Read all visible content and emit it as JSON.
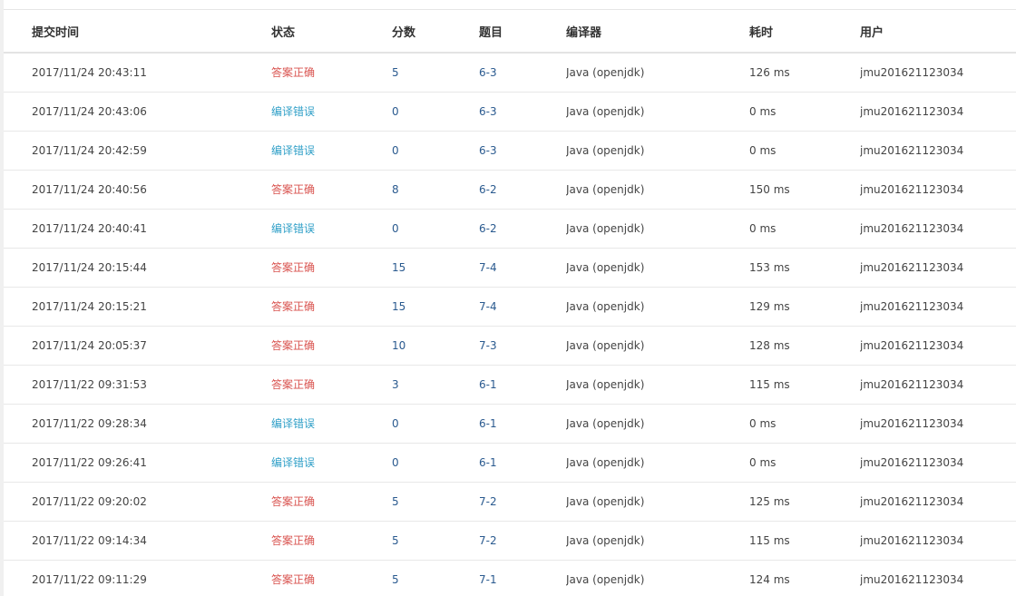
{
  "colors": {
    "accepted": "#d9534f",
    "compile_error": "#31a0c8",
    "link": "#2a5a8f"
  },
  "table": {
    "headers": [
      "提交时间",
      "状态",
      "分数",
      "题目",
      "编译器",
      "耗时",
      "用户"
    ],
    "rows": [
      {
        "time": "2017/11/24 20:43:11",
        "status": "答案正确",
        "status_type": "accepted",
        "score": "5",
        "problem": "6-3",
        "compiler": "Java (openjdk)",
        "duration": "126 ms",
        "user": "jmu201621123034"
      },
      {
        "time": "2017/11/24 20:43:06",
        "status": "编译错误",
        "status_type": "compile_error",
        "score": "0",
        "problem": "6-3",
        "compiler": "Java (openjdk)",
        "duration": "0 ms",
        "user": "jmu201621123034"
      },
      {
        "time": "2017/11/24 20:42:59",
        "status": "编译错误",
        "status_type": "compile_error",
        "score": "0",
        "problem": "6-3",
        "compiler": "Java (openjdk)",
        "duration": "0 ms",
        "user": "jmu201621123034"
      },
      {
        "time": "2017/11/24 20:40:56",
        "status": "答案正确",
        "status_type": "accepted",
        "score": "8",
        "problem": "6-2",
        "compiler": "Java (openjdk)",
        "duration": "150 ms",
        "user": "jmu201621123034"
      },
      {
        "time": "2017/11/24 20:40:41",
        "status": "编译错误",
        "status_type": "compile_error",
        "score": "0",
        "problem": "6-2",
        "compiler": "Java (openjdk)",
        "duration": "0 ms",
        "user": "jmu201621123034"
      },
      {
        "time": "2017/11/24 20:15:44",
        "status": "答案正确",
        "status_type": "accepted",
        "score": "15",
        "problem": "7-4",
        "compiler": "Java (openjdk)",
        "duration": "153 ms",
        "user": "jmu201621123034"
      },
      {
        "time": "2017/11/24 20:15:21",
        "status": "答案正确",
        "status_type": "accepted",
        "score": "15",
        "problem": "7-4",
        "compiler": "Java (openjdk)",
        "duration": "129 ms",
        "user": "jmu201621123034"
      },
      {
        "time": "2017/11/24 20:05:37",
        "status": "答案正确",
        "status_type": "accepted",
        "score": "10",
        "problem": "7-3",
        "compiler": "Java (openjdk)",
        "duration": "128 ms",
        "user": "jmu201621123034"
      },
      {
        "time": "2017/11/22 09:31:53",
        "status": "答案正确",
        "status_type": "accepted",
        "score": "3",
        "problem": "6-1",
        "compiler": "Java (openjdk)",
        "duration": "115 ms",
        "user": "jmu201621123034"
      },
      {
        "time": "2017/11/22 09:28:34",
        "status": "编译错误",
        "status_type": "compile_error",
        "score": "0",
        "problem": "6-1",
        "compiler": "Java (openjdk)",
        "duration": "0 ms",
        "user": "jmu201621123034"
      },
      {
        "time": "2017/11/22 09:26:41",
        "status": "编译错误",
        "status_type": "compile_error",
        "score": "0",
        "problem": "6-1",
        "compiler": "Java (openjdk)",
        "duration": "0 ms",
        "user": "jmu201621123034"
      },
      {
        "time": "2017/11/22 09:20:02",
        "status": "答案正确",
        "status_type": "accepted",
        "score": "5",
        "problem": "7-2",
        "compiler": "Java (openjdk)",
        "duration": "125 ms",
        "user": "jmu201621123034"
      },
      {
        "time": "2017/11/22 09:14:34",
        "status": "答案正确",
        "status_type": "accepted",
        "score": "5",
        "problem": "7-2",
        "compiler": "Java (openjdk)",
        "duration": "115 ms",
        "user": "jmu201621123034"
      },
      {
        "time": "2017/11/22 09:11:29",
        "status": "答案正确",
        "status_type": "accepted",
        "score": "5",
        "problem": "7-1",
        "compiler": "Java (openjdk)",
        "duration": "124 ms",
        "user": "jmu201621123034"
      }
    ]
  }
}
